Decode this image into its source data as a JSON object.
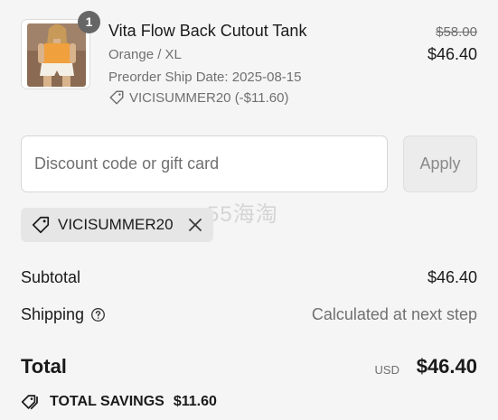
{
  "product": {
    "quantity": "1",
    "name": "Vita Flow Back Cutout Tank",
    "variant": "Orange / XL",
    "preorder": "Preorder Ship Date: 2025-08-15",
    "discount_applied": "VICISUMMER20 (-$11.60)",
    "price_original": "$58.00",
    "price_current": "$46.40"
  },
  "discount": {
    "placeholder": "Discount code or gift card",
    "value": "",
    "apply_label": "Apply",
    "applied_code": "VICISUMMER20"
  },
  "watermark": "55海淘",
  "summary": {
    "subtotal_label": "Subtotal",
    "subtotal_value": "$46.40",
    "shipping_label": "Shipping",
    "shipping_value": "Calculated at next step",
    "total_label": "Total",
    "total_currency": "USD",
    "total_value": "$46.40",
    "savings_label": "TOTAL SAVINGS",
    "savings_value": "$11.60"
  },
  "icons": {
    "tag": "tag-icon",
    "close": "close-icon",
    "help": "help-circle-icon",
    "savings": "tags-icon"
  },
  "colors": {
    "background": "#f5f5f5",
    "muted_text": "#707070",
    "badge": "#666666",
    "chip": "#e6e6e6",
    "product_orange": "#f0a03c"
  }
}
